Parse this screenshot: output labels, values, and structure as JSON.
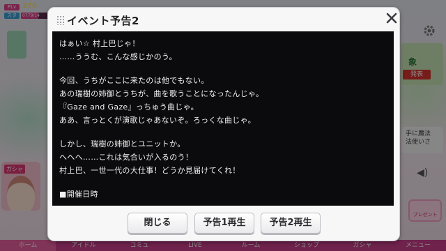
{
  "status": {
    "plv_label": "PLv",
    "plv_value": "270",
    "stamina_label": "スタ",
    "stamina_text": "0779/14",
    "stamina_fill": 0.55
  },
  "background": {
    "right_top_text": "象",
    "right_top_badge": "発表",
    "right_mid_text": "手に魔法\n法使いさ",
    "gacha_label": "ガシャ",
    "present_label": "プレゼント"
  },
  "dialog": {
    "title": "イベント予告2",
    "paragraphs": [
      [
        "はぁい☆ 村上巴じゃ！",
        "……ううむ、こんな感じかのう。"
      ],
      [
        "今回、うちがここに来たのは他でもない。",
        "あの瑞樹の姉御とうちが、曲を歌うことになったんじゃ。",
        "『Gaze and Gaze』っちゅう曲じゃ。",
        "ああ、言っとくが演歌じゃあないぞ。ろっくな曲じゃ。"
      ],
      [
        "しかし、瑞樹の姉御とユニットか。",
        "へへへ……これは気合いが入るのう！",
        "村上巴、一世一代の大仕事！どうか見届けてくれ！"
      ],
      [
        "■開催日時"
      ]
    ],
    "buttons": {
      "close": "閉じる",
      "preview1": "予告1再生",
      "preview2": "予告2再生"
    }
  },
  "bottom_nav": [
    "ホーム",
    "アイドル",
    "コミュ",
    "LIVE",
    "ルーム",
    "ショップ",
    "ガシャ",
    "メニュー"
  ],
  "colors": {
    "accent": "#c83f8a",
    "dialog_bg": "#f7f7f8",
    "content_bg": "#0b0b0d"
  }
}
